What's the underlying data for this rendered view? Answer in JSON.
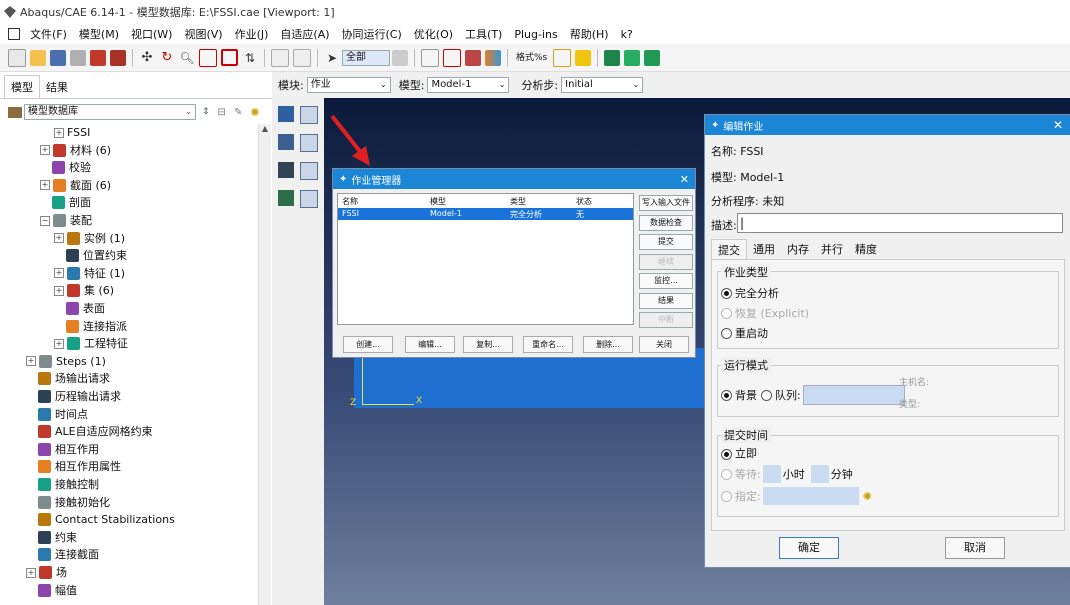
{
  "window": {
    "title": "Abaqus/CAE 6.14-1 - 模型数据库: E:\\FSSI.cae [Viewport: 1]"
  },
  "menu": [
    "文件(F)",
    "模型(M)",
    "视口(W)",
    "视图(V)",
    "作业(J)",
    "自适应(A)",
    "协同运行(C)",
    "优化(O)",
    "工具(T)",
    "Plug-ins",
    "帮助(H)",
    "k?"
  ],
  "toolbar": {
    "render_combo": "全部",
    "style_label": "格式%s"
  },
  "left": {
    "tabs": [
      "模型",
      "结果"
    ],
    "combo": "模型数据库",
    "tree": [
      {
        "label": "FSSI",
        "depth": 3,
        "expander": "⊞",
        "icon": "none"
      },
      {
        "label": "材料 (6)",
        "depth": 2,
        "expander": "⊞",
        "icon": "material-icon"
      },
      {
        "label": "校验",
        "depth": 2,
        "expander": "",
        "icon": "calibration-icon"
      },
      {
        "label": "截面 (6)",
        "depth": 2,
        "expander": "⊞",
        "icon": "section-icon"
      },
      {
        "label": "剖面",
        "depth": 2,
        "expander": "",
        "icon": "profile-icon"
      },
      {
        "label": "装配",
        "depth": 2,
        "expander": "⊟",
        "icon": "assembly-icon"
      },
      {
        "label": "实例 (1)",
        "depth": 3,
        "expander": "⊞",
        "icon": "instance-icon"
      },
      {
        "label": "位置约束",
        "depth": 3,
        "expander": "",
        "icon": "position-constraint-icon"
      },
      {
        "label": "特征 (1)",
        "depth": 3,
        "expander": "⊞",
        "icon": "feature-icon"
      },
      {
        "label": "集 (6)",
        "depth": 3,
        "expander": "⊞",
        "icon": "set-icon"
      },
      {
        "label": "表面",
        "depth": 3,
        "expander": "",
        "icon": "surface-icon"
      },
      {
        "label": "连接指派",
        "depth": 3,
        "expander": "",
        "icon": "connector-assignment-icon"
      },
      {
        "label": "工程特征",
        "depth": 3,
        "expander": "⊞",
        "icon": "engineering-feature-icon"
      },
      {
        "label": "Steps (1)",
        "depth": 1,
        "expander": "⊞",
        "icon": "steps-icon"
      },
      {
        "label": "场输出请求",
        "depth": 1,
        "expander": "",
        "icon": "field-output-icon"
      },
      {
        "label": "历程输出请求",
        "depth": 1,
        "expander": "",
        "icon": "history-output-icon"
      },
      {
        "label": "时间点",
        "depth": 1,
        "expander": "",
        "icon": "time-points-icon"
      },
      {
        "label": "ALE自适应网格约束",
        "depth": 1,
        "expander": "",
        "icon": "ale-icon"
      },
      {
        "label": "相互作用",
        "depth": 1,
        "expander": "",
        "icon": "interaction-icon"
      },
      {
        "label": "相互作用属性",
        "depth": 1,
        "expander": "",
        "icon": "interaction-property-icon"
      },
      {
        "label": "接触控制",
        "depth": 1,
        "expander": "",
        "icon": "contact-control-icon"
      },
      {
        "label": "接触初始化",
        "depth": 1,
        "expander": "",
        "icon": "contact-init-icon"
      },
      {
        "label": "Contact Stabilizations",
        "depth": 1,
        "expander": "",
        "icon": "contact-stab-icon"
      },
      {
        "label": "约束",
        "depth": 1,
        "expander": "",
        "icon": "constraint-icon"
      },
      {
        "label": "连接截面",
        "depth": 1,
        "expander": "",
        "icon": "connector-section-icon"
      },
      {
        "label": "场",
        "depth": 1,
        "expander": "⊞",
        "icon": "field-icon"
      },
      {
        "label": "幅值",
        "depth": 1,
        "expander": "",
        "icon": "amplitude-icon"
      }
    ]
  },
  "modbar": {
    "module_label": "模块:",
    "module_value": "作业",
    "model_label": "模型:",
    "model_value": "Model-1",
    "step_label": "分析步:",
    "step_value": "Initial"
  },
  "job_manager": {
    "title": "作业管理器",
    "columns": [
      "名称",
      "模型",
      "类型",
      "状态"
    ],
    "rows": [
      [
        "FSSI",
        "Model-1",
        "完全分析",
        "无"
      ]
    ],
    "side_buttons": [
      {
        "label": "写入输入文件",
        "enabled": true
      },
      {
        "label": "数据检查",
        "enabled": true
      },
      {
        "label": "提交",
        "enabled": true
      },
      {
        "label": "继续",
        "enabled": false
      },
      {
        "label": "监控...",
        "enabled": true
      },
      {
        "label": "结果",
        "enabled": true
      },
      {
        "label": "中断",
        "enabled": false
      }
    ],
    "bottom_buttons": [
      "创建...",
      "编辑...",
      "复制...",
      "重命名...",
      "删除..."
    ],
    "close_label": "关闭"
  },
  "edit_job": {
    "title": "编辑作业",
    "name_row": "名称: FSSI",
    "model_row": "模型: Model-1",
    "analysis_row": "分析程序: 未知",
    "desc_label": "描述:",
    "desc_value": "",
    "tabs": [
      "提交",
      "通用",
      "内存",
      "并行",
      "精度"
    ],
    "job_type_title": "作业类型",
    "job_types": [
      {
        "label": "完全分析",
        "selected": true,
        "enabled": true
      },
      {
        "label": "恢复 (Explicit)",
        "selected": false,
        "enabled": false
      },
      {
        "label": "重启动",
        "selected": false,
        "enabled": true
      }
    ],
    "run_mode_title": "运行模式",
    "background": "背景",
    "queue": "队列:",
    "host_name": "主机名:",
    "type": "类型:",
    "submit_time_title": "提交时间",
    "immediately": "立即",
    "wait": "等待:",
    "hours": "小时",
    "minutes": "分钟",
    "at": "指定:",
    "ok": "确定",
    "cancel": "取消"
  },
  "viewport": {
    "axis_x": "X",
    "axis_z": "Z"
  },
  "colors": {
    "dialog_header": "#1c86d6",
    "selection": "#1a73d9",
    "viewport_top": "#0b1a3a",
    "part": "#1f6fd1"
  }
}
